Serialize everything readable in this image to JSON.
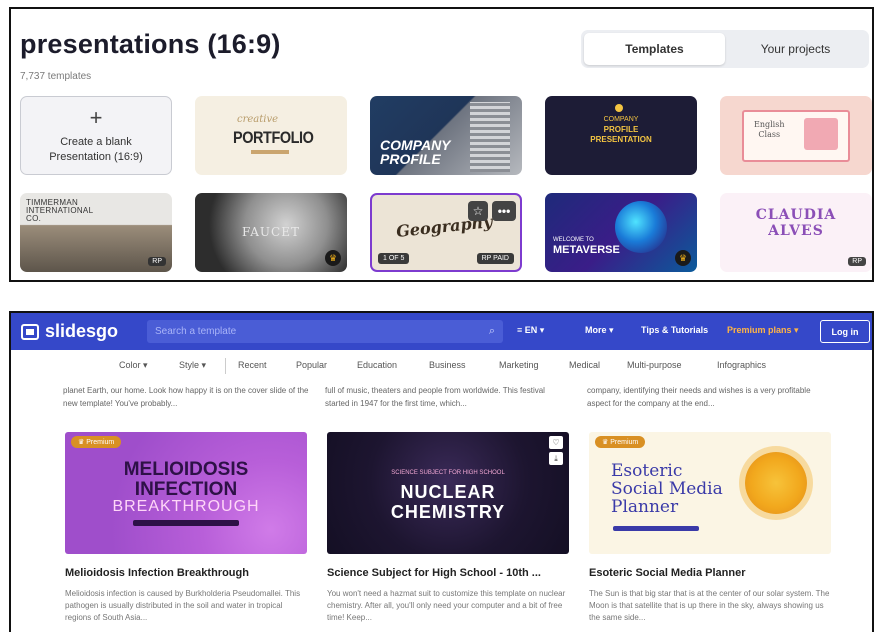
{
  "canva": {
    "title": "presentations (16:9)",
    "count": "7,737 templates",
    "tabs": [
      "Templates",
      "Your projects"
    ],
    "blank_tile": {
      "plus": "+",
      "line1": "Create a blank",
      "line2": "Presentation (16:9)"
    },
    "templates": {
      "portfolio": {
        "small": "creative",
        "big": "PORTFOLIO"
      },
      "company": {
        "line1": "COMPANY",
        "line2": "PROFILE"
      },
      "profile": {
        "line1": "COMPANY",
        "line2": "PROFILE",
        "line3": "PRESENTATION"
      },
      "english": {
        "line1": "English",
        "line2": "Class"
      },
      "timmerman": {
        "line1": "TIMMERMAN",
        "line2": "INTERNATIONAL",
        "line3": "CO.",
        "badge": "RP"
      },
      "faucet": {
        "text": "FAUCET"
      },
      "geography": {
        "text": "Geography",
        "badge_left": "1 OF 5",
        "badge_right": "RP PAID",
        "star": "☆",
        "more": "•••"
      },
      "metaverse": {
        "line1": "WELCOME TO",
        "line2": "METAVERSE"
      },
      "claudia": {
        "line1": "CLAUDIA",
        "line2": "ALVES",
        "badge": "RP"
      }
    },
    "crown_icon": "♛"
  },
  "slidesgo": {
    "logo": "slidesgo",
    "search_placeholder": "Search a template",
    "search_icon": "⌕",
    "lang": "≡ EN ▾",
    "more": "More ▾",
    "tips": "Tips & Tutorials",
    "premium": "Premium plans ▾",
    "login": "Log in",
    "categories": [
      "Color ▾",
      "Style ▾",
      "Recent",
      "Popular",
      "Education",
      "Business",
      "Marketing",
      "Medical",
      "Multi-purpose",
      "Infographics"
    ],
    "blurbs": [
      "planet Earth, our home. Look how happy it is on the cover slide of the new template! You've probably...",
      "full of music, theaters and people from worldwide. This festival started in 1947 for the first time, which...",
      "company, identifying their needs and wishes is a very profitable aspect for the company at the end..."
    ],
    "premium_badge": "♛ Premium",
    "cards": [
      {
        "image_lines": [
          "MELIOIDOSIS",
          "INFECTION",
          "BREAKTHROUGH"
        ],
        "title": "Melioidosis Infection Breakthrough",
        "desc": "Melioidosis infection is caused by Burkholderia Pseudomallei. This pathogen is usually distributed in the soil and water in tropical regions of South Asia..."
      },
      {
        "image_small": "SCIENCE SUBJECT FOR HIGH SCHOOL",
        "image_lines": [
          "NUCLEAR",
          "CHEMISTRY"
        ],
        "title": "Science Subject for High School - 10th ...",
        "desc": "You won't need a hazmat suit to customize this template on nuclear chemistry. After all, you'll only need your computer and a bit of free time! Keep..."
      },
      {
        "image_lines": [
          "Esoteric",
          "Social Media",
          "Planner"
        ],
        "title": "Esoteric Social Media Planner",
        "desc": "The Sun is that big star that is at the center of our solar system. The Moon is that satellite that is up there in the sky, always showing us the same side..."
      }
    ],
    "card_icons": [
      "♡",
      "⤓"
    ]
  },
  "colors": {
    "slidesgo_blue": "#3548c9",
    "premium_orange": "#d99023",
    "canva_dark": "#1c1c2b"
  }
}
